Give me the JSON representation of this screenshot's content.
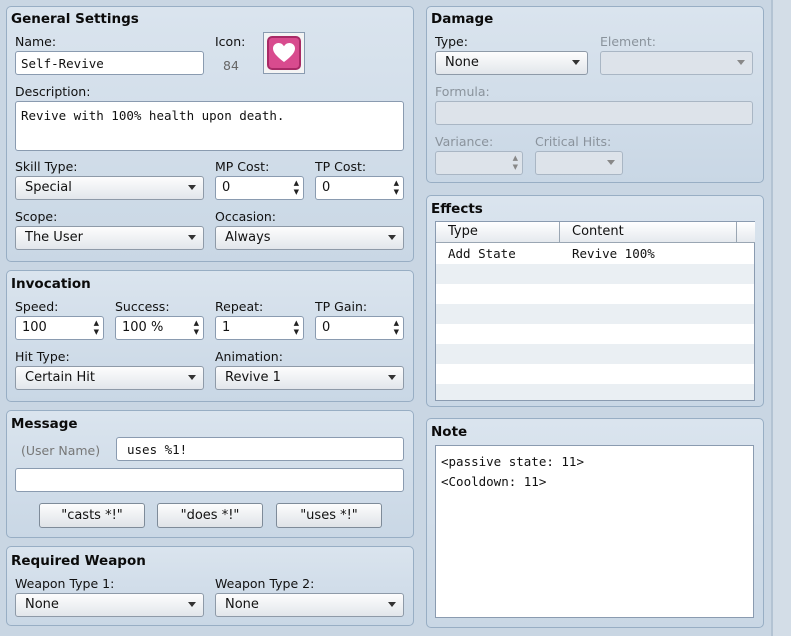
{
  "general": {
    "title": "General Settings",
    "name_label": "Name:",
    "name_value": "Self-Revive",
    "icon_label": "Icon:",
    "icon_index": "84",
    "icon_semantic": "heart-icon",
    "description_label": "Description:",
    "description_value": "Revive with 100% health upon death.",
    "skill_type_label": "Skill Type:",
    "skill_type_value": "Special",
    "mp_cost_label": "MP Cost:",
    "mp_cost_value": "0",
    "tp_cost_label": "TP Cost:",
    "tp_cost_value": "0",
    "scope_label": "Scope:",
    "scope_value": "The User",
    "occasion_label": "Occasion:",
    "occasion_value": "Always"
  },
  "invocation": {
    "title": "Invocation",
    "speed_label": "Speed:",
    "speed_value": "100",
    "success_label": "Success:",
    "success_value": "100 %",
    "repeat_label": "Repeat:",
    "repeat_value": "1",
    "tp_gain_label": "TP Gain:",
    "tp_gain_value": "0",
    "hit_type_label": "Hit Type:",
    "hit_type_value": "Certain Hit",
    "animation_label": "Animation:",
    "animation_value": "Revive 1"
  },
  "message": {
    "title": "Message",
    "user_name_label": "(User Name)",
    "line1_value": "uses %1!",
    "line2_value": "",
    "buttons": [
      "\"casts *!\"",
      "\"does *!\"",
      "\"uses *!\""
    ]
  },
  "required_weapon": {
    "title": "Required Weapon",
    "type1_label": "Weapon Type 1:",
    "type1_value": "None",
    "type2_label": "Weapon Type 2:",
    "type2_value": "None"
  },
  "damage": {
    "title": "Damage",
    "type_label": "Type:",
    "type_value": "None",
    "element_label": "Element:",
    "element_value": "",
    "formula_label": "Formula:",
    "formula_value": "",
    "variance_label": "Variance:",
    "variance_value": "",
    "critical_label": "Critical Hits:",
    "critical_value": ""
  },
  "effects": {
    "title": "Effects",
    "columns": [
      "Type",
      "Content"
    ],
    "rows": [
      {
        "type": "Add State",
        "content": "Revive 100%"
      }
    ]
  },
  "note": {
    "title": "Note",
    "lines": [
      "<passive state: 11>",
      "<Cooldown: 11>"
    ]
  },
  "colors": {
    "panel_bg": "#d4dfea",
    "icon_pink": "#d84b8e"
  }
}
